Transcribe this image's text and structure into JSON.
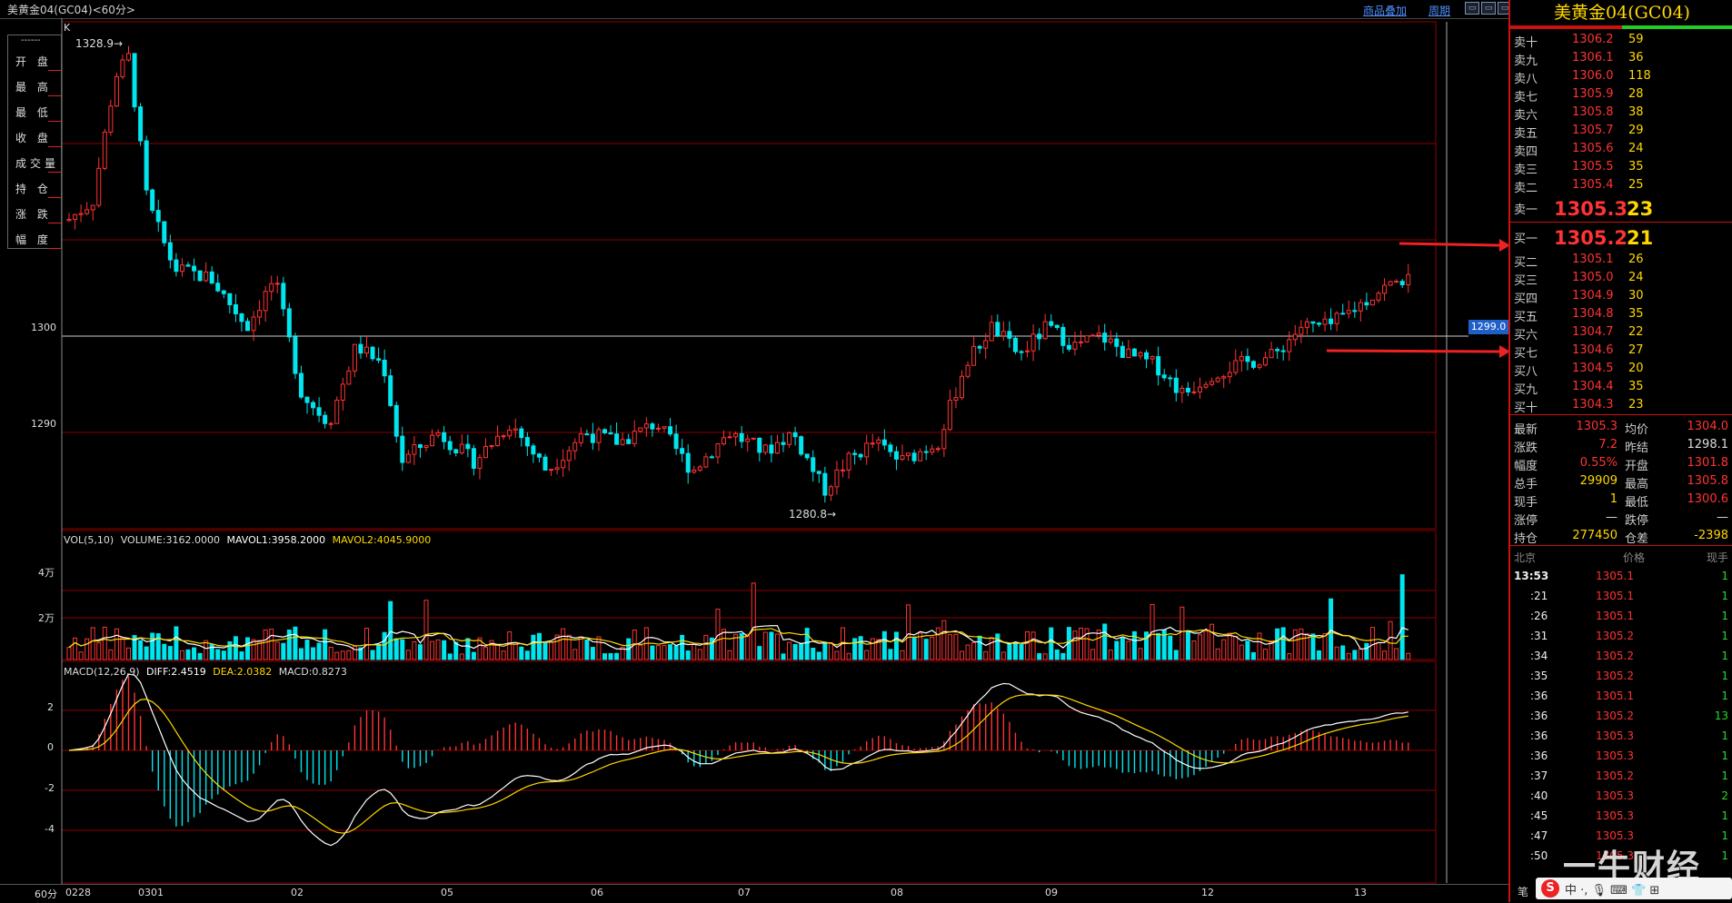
{
  "window": {
    "title": "美黄金04(GC04)<60分>",
    "links": [
      "商品叠加",
      "周期"
    ],
    "win_buttons": [
      "▭",
      "▭",
      "▭"
    ]
  },
  "chart": {
    "k_label": "K",
    "high_label": "1328.9→",
    "low_label": "1280.8→",
    "price_ticks": [
      "1300",
      "1290"
    ],
    "price_tag": "1299.0",
    "vol_header": {
      "prefix": "VOL(5,10)",
      "volume": "VOLUME:3162.0000",
      "ma1": "MAVOL1:3958.2000",
      "ma2": "MAVOL2:4045.9000"
    },
    "vol_ticks": [
      "4万",
      "2万"
    ],
    "macd_header": {
      "prefix": "MACD(12,26,9)",
      "diff": "DIFF:2.4519",
      "dea": "DEA:2.0382",
      "macd": "MACD:0.8273"
    },
    "macd_ticks": [
      "2",
      "0",
      "-2",
      "-4"
    ],
    "period_label": "60分",
    "x_labels": [
      "0228",
      "0301",
      "02",
      "05",
      "06",
      "07",
      "08",
      "09",
      "12",
      "13"
    ],
    "colors": {
      "up": "#ff3333",
      "down": "#00e5ee",
      "grid": "#8b0000",
      "diff": "#ffffff",
      "dea": "#ffd800"
    }
  },
  "info_box": {
    "dashes": "------",
    "rows": [
      "开 盘",
      "最 高",
      "最 低",
      "收 盘",
      "成交量",
      "持 仓",
      "涨 跌",
      "幅 度"
    ]
  },
  "panel": {
    "title": "美黄金04(GC04)",
    "asks": [
      {
        "label": "卖十",
        "price": "1306.2",
        "vol": "59"
      },
      {
        "label": "卖九",
        "price": "1306.1",
        "vol": "36"
      },
      {
        "label": "卖八",
        "price": "1306.0",
        "vol": "118"
      },
      {
        "label": "卖七",
        "price": "1305.9",
        "vol": "28"
      },
      {
        "label": "卖六",
        "price": "1305.8",
        "vol": "38"
      },
      {
        "label": "卖五",
        "price": "1305.7",
        "vol": "29"
      },
      {
        "label": "卖四",
        "price": "1305.6",
        "vol": "24"
      },
      {
        "label": "卖三",
        "price": "1305.5",
        "vol": "35"
      },
      {
        "label": "卖二",
        "price": "1305.4",
        "vol": "25"
      },
      {
        "label": "卖一",
        "price": "1305.3",
        "vol": "23"
      }
    ],
    "bids": [
      {
        "label": "买一",
        "price": "1305.2",
        "vol": "21"
      },
      {
        "label": "买二",
        "price": "1305.1",
        "vol": "26"
      },
      {
        "label": "买三",
        "price": "1305.0",
        "vol": "24"
      },
      {
        "label": "买四",
        "price": "1304.9",
        "vol": "30"
      },
      {
        "label": "买五",
        "price": "1304.8",
        "vol": "35"
      },
      {
        "label": "买六",
        "price": "1304.7",
        "vol": "22"
      },
      {
        "label": "买七",
        "price": "1304.6",
        "vol": "27"
      },
      {
        "label": "买八",
        "price": "1304.5",
        "vol": "20"
      },
      {
        "label": "买九",
        "price": "1304.4",
        "vol": "35"
      },
      {
        "label": "买十",
        "price": "1304.3",
        "vol": "23"
      }
    ],
    "stats": [
      {
        "l1": "最新",
        "v1": "1305.3",
        "c1": "#ff3333",
        "l2": "均价",
        "v2": "1304.0",
        "c2": "#ff3333"
      },
      {
        "l1": "涨跌",
        "v1": "7.2",
        "c1": "#ff3333",
        "l2": "昨结",
        "v2": "1298.1",
        "c2": "#dddddd"
      },
      {
        "l1": "幅度",
        "v1": "0.55%",
        "c1": "#ff3333",
        "l2": "开盘",
        "v2": "1301.8",
        "c2": "#ff3333"
      },
      {
        "l1": "总手",
        "v1": "29909",
        "c1": "#ffd800",
        "l2": "最高",
        "v2": "1305.8",
        "c2": "#ff3333"
      },
      {
        "l1": "现手",
        "v1": "1",
        "c1": "#ffd800",
        "l2": "最低",
        "v2": "1300.6",
        "c2": "#ff3333"
      },
      {
        "l1": "涨停",
        "v1": "—",
        "c1": "#dddddd",
        "l2": "跌停",
        "v2": "—",
        "c2": "#dddddd"
      },
      {
        "l1": "持仓",
        "v1": "277450",
        "c1": "#ffd800",
        "l2": "仓差",
        "v2": "-2398",
        "c2": "#ffd800"
      }
    ],
    "tick_header": {
      "time": "北京",
      "price": "价格",
      "qty": "现手"
    },
    "ticks": [
      {
        "time": "13:53",
        "price": "1305.1",
        "qty": "1"
      },
      {
        "time": ":21",
        "price": "1305.1",
        "qty": "1"
      },
      {
        "time": ":26",
        "price": "1305.1",
        "qty": "1"
      },
      {
        "time": ":31",
        "price": "1305.2",
        "qty": "1"
      },
      {
        "time": ":34",
        "price": "1305.2",
        "qty": "1"
      },
      {
        "time": ":35",
        "price": "1305.2",
        "qty": "1"
      },
      {
        "time": ":36",
        "price": "1305.1",
        "qty": "1"
      },
      {
        "time": ":36",
        "price": "1305.2",
        "qty": "13"
      },
      {
        "time": ":36",
        "price": "1305.3",
        "qty": "1"
      },
      {
        "time": ":36",
        "price": "1305.3",
        "qty": "1"
      },
      {
        "time": ":37",
        "price": "1305.2",
        "qty": "1"
      },
      {
        "time": ":40",
        "price": "1305.3",
        "qty": "2"
      },
      {
        "time": ":45",
        "price": "1305.3",
        "qty": "1"
      },
      {
        "time": ":47",
        "price": "1305.3",
        "qty": "1"
      },
      {
        "time": ":50",
        "price": "1305.3",
        "qty": "1"
      }
    ],
    "bottom_label": "笔"
  },
  "watermark": "一牛财经",
  "ime": {
    "logo": "S",
    "text": "中 ·,  🎙 ⌨ 👕 ⊞"
  }
}
